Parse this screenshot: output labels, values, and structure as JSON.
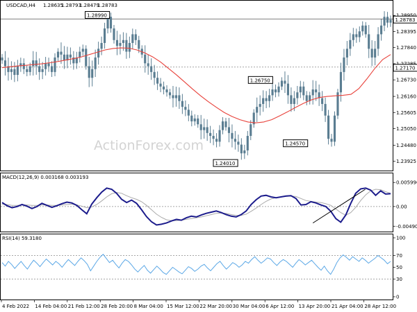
{
  "header": {
    "symbol": "USDCAD,H4",
    "open": "1.28635",
    "high": "1.28793",
    "low": "1.28479",
    "close": "1.28783"
  },
  "watermark": "ActionForex.com",
  "colors": {
    "candle": "#5a7d91",
    "ma": "#e8413a",
    "macd": "#1c1c8c",
    "signal": "#aaaaaa",
    "rsi": "#5aa7e6",
    "trend": "#000000",
    "guide": "#888888"
  },
  "chart_data": [
    {
      "type": "candlestick",
      "title": "USDCAD,H4",
      "x_labels": [
        "4 Feb 2022",
        "14 Feb 04:00",
        "21 Feb 12:00",
        "28 Feb 20:00",
        "8 Mar 04:00",
        "15 Mar 12:00",
        "22 Mar 20:00",
        "30 Mar 04:00",
        "6 Apr 12:00",
        "13 Apr 20:00",
        "21 Apr 04:00",
        "28 Apr 12:00"
      ],
      "y_ticks": [
        "1.28950",
        "1.28395",
        "1.27840",
        "1.27285",
        "1.26730",
        "1.26160",
        "1.25605",
        "1.25050",
        "1.24480",
        "1.23925"
      ],
      "ylim": [
        1.2375,
        1.2905
      ],
      "current_price": "1.28783",
      "horizontal_level": "1.27170",
      "annotations": [
        "1.28990",
        "1.26750",
        "1.24570",
        "1.24010"
      ],
      "close_path": [
        1.274,
        1.272,
        1.27,
        1.271,
        1.269,
        1.272,
        1.273,
        1.271,
        1.27,
        1.272,
        1.274,
        1.272,
        1.27,
        1.271,
        1.273,
        1.272,
        1.27,
        1.275,
        1.277,
        1.276,
        1.274,
        1.276,
        1.275,
        1.273,
        1.275,
        1.277,
        1.278,
        1.272,
        1.268,
        1.271,
        1.275,
        1.278,
        1.28,
        1.285,
        1.289,
        1.285,
        1.281,
        1.279,
        1.28,
        1.281,
        1.277,
        1.28,
        1.283,
        1.281,
        1.278,
        1.276,
        1.273,
        1.272,
        1.27,
        1.268,
        1.266,
        1.265,
        1.264,
        1.263,
        1.262,
        1.261,
        1.262,
        1.26,
        1.258,
        1.257,
        1.255,
        1.253,
        1.254,
        1.252,
        1.25,
        1.251,
        1.249,
        1.248,
        1.247,
        1.246,
        1.25,
        1.253,
        1.251,
        1.249,
        1.247,
        1.246,
        1.245,
        1.242,
        1.243,
        1.248,
        1.252,
        1.256,
        1.258,
        1.259,
        1.261,
        1.26,
        1.262,
        1.264,
        1.263,
        1.265,
        1.267,
        1.266,
        1.262,
        1.259,
        1.261,
        1.263,
        1.265,
        1.262,
        1.26,
        1.262,
        1.264,
        1.263,
        1.261,
        1.259,
        1.255,
        1.247,
        1.246,
        1.255,
        1.263,
        1.27,
        1.275,
        1.278,
        1.281,
        1.283,
        1.282,
        1.284,
        1.286,
        1.283,
        1.278,
        1.275,
        1.278,
        1.283,
        1.286,
        1.289,
        1.287,
        1.288
      ],
      "moving_average_path": [
        1.2715,
        1.2718,
        1.2721,
        1.2723,
        1.2726,
        1.2728,
        1.2732,
        1.2736,
        1.2741,
        1.2746,
        1.2752,
        1.276,
        1.2768,
        1.2776,
        1.2781,
        1.2783,
        1.2782,
        1.2776,
        1.2766,
        1.2752,
        1.2734,
        1.2712,
        1.269,
        1.2666,
        1.2642,
        1.2619,
        1.2598,
        1.2579,
        1.2561,
        1.2547,
        1.2536,
        1.2528,
        1.2525,
        1.2528,
        1.2536,
        1.2549,
        1.2563,
        1.2578,
        1.2592,
        1.2604,
        1.2612,
        1.2616,
        1.2618,
        1.262,
        1.2623,
        1.2643,
        1.2676,
        1.2712,
        1.2743,
        1.276
      ]
    },
    {
      "type": "line",
      "title": "MACD(12,26,9) 0.003168 0.003193",
      "y_ticks": [
        "0.005996",
        "0.00",
        "-0.004901"
      ],
      "ylim": [
        -0.0052,
        0.0062
      ],
      "macd_path": [
        0.001,
        0.0002,
        -0.0003,
        0.0,
        0.0005,
        0.0001,
        -0.0005,
        0.0,
        0.0008,
        0.0003,
        -0.0002,
        0.0002,
        0.0007,
        0.0011,
        0.0009,
        0.0003,
        -0.0008,
        -0.0018,
        0.0006,
        0.0022,
        0.0036,
        0.0046,
        0.0043,
        0.0033,
        0.0018,
        0.001,
        0.0016,
        0.0008,
        -0.0008,
        -0.0025,
        -0.0038,
        -0.0046,
        -0.0044,
        -0.0041,
        -0.0036,
        -0.0032,
        -0.0034,
        -0.0028,
        -0.0024,
        -0.0026,
        -0.0021,
        -0.0017,
        -0.0014,
        -0.0011,
        -0.0015,
        -0.002,
        -0.0024,
        -0.0026,
        -0.002,
        -0.0011,
        0.0005,
        0.0017,
        0.0026,
        0.0028,
        0.0024,
        0.0022,
        0.0024,
        0.0026,
        0.0027,
        0.002,
        0.0004,
        0.0005,
        0.0012,
        0.0009,
        0.0004,
        0.0,
        -0.0012,
        -0.003,
        -0.0039,
        -0.0021,
        0.0008,
        0.0033,
        0.0044,
        0.0046,
        0.0041,
        0.0028,
        0.0039,
        0.0031,
        0.0032
      ],
      "signal_path": [
        0.0006,
        0.0005,
        0.0003,
        0.0003,
        0.0004,
        0.0004,
        0.0003,
        0.0003,
        0.0004,
        0.0004,
        0.0003,
        0.0003,
        0.0004,
        0.0005,
        0.0006,
        0.0004,
        0.0001,
        -0.0003,
        -0.0001,
        0.0005,
        0.0014,
        0.0024,
        0.0032,
        0.0035,
        0.0033,
        0.0027,
        0.0022,
        0.0018,
        0.0012,
        0.0003,
        -0.0008,
        -0.0019,
        -0.0027,
        -0.0033,
        -0.0035,
        -0.0035,
        -0.0034,
        -0.0032,
        -0.003,
        -0.0028,
        -0.0026,
        -0.0023,
        -0.002,
        -0.0017,
        -0.0016,
        -0.0017,
        -0.002,
        -0.0022,
        -0.0022,
        -0.0019,
        -0.0012,
        -0.0004,
        0.0005,
        0.0013,
        0.0019,
        0.0022,
        0.0024,
        0.0025,
        0.0026,
        0.0025,
        0.002,
        0.0015,
        0.0013,
        0.0011,
        0.001,
        0.0007,
        0.0003,
        -0.0006,
        -0.0015,
        -0.0022,
        -0.0015,
        -0.0002,
        0.0015,
        0.0029,
        0.0039,
        0.0043,
        0.0042,
        0.0037,
        0.0033
      ],
      "trendline": [
        [
          0.8,
          -0.0041
        ],
        [
          0.935,
          0.0043
        ]
      ]
    },
    {
      "type": "line",
      "title": "RSI(14) 59.3180",
      "y_ticks": [
        "100",
        "70",
        "50",
        "30",
        "0"
      ],
      "ylim": [
        0,
        100
      ],
      "levels": [
        70,
        30
      ],
      "rsi_path": [
        58,
        52,
        60,
        55,
        48,
        54,
        60,
        53,
        47,
        55,
        62,
        57,
        51,
        58,
        64,
        59,
        54,
        60,
        56,
        50,
        57,
        63,
        58,
        53,
        60,
        66,
        61,
        55,
        44,
        52,
        60,
        67,
        72,
        65,
        58,
        62,
        55,
        49,
        57,
        63,
        60,
        54,
        47,
        42,
        48,
        53,
        45,
        40,
        46,
        52,
        47,
        41,
        38,
        44,
        50,
        46,
        42,
        39,
        45,
        51,
        48,
        43,
        47,
        52,
        55,
        49,
        44,
        50,
        56,
        60,
        53,
        47,
        52,
        58,
        55,
        50,
        54,
        60,
        57,
        63,
        68,
        62,
        57,
        61,
        66,
        64,
        58,
        53,
        59,
        63,
        60,
        55,
        50,
        57,
        63,
        59,
        54,
        58,
        62,
        56,
        50,
        45,
        52,
        44,
        38,
        47,
        58,
        66,
        71,
        67,
        62,
        68,
        64,
        60,
        66,
        62,
        57,
        61,
        65,
        70,
        66,
        62,
        56,
        60
      ]
    }
  ]
}
